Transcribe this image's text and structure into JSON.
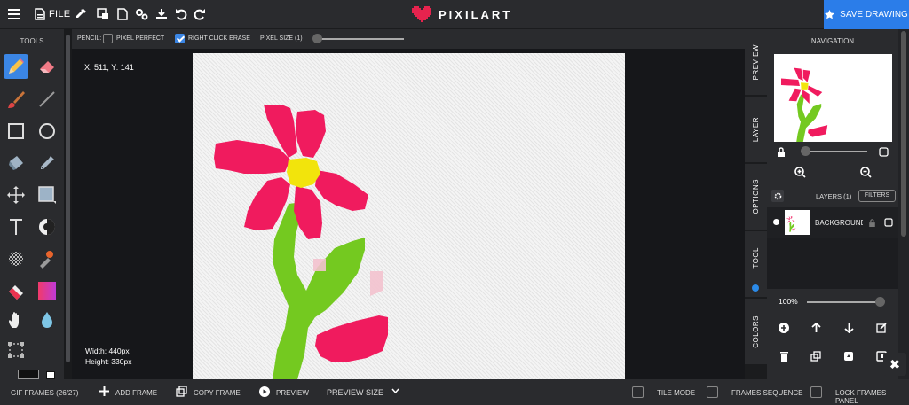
{
  "topbar": {
    "file_label": "FILE",
    "logo_text": "PIXILART",
    "save_label": "SAVE DRAWING",
    "colors": {
      "accent": "#2b7de9",
      "logo_heart": "#e6234e"
    },
    "icons": [
      "file-icon",
      "eyedropper-icon",
      "resize-icon",
      "document-icon",
      "settings-icon",
      "download-icon",
      "undo-icon",
      "redo-icon"
    ]
  },
  "tools": {
    "title": "TOOLS",
    "items": [
      "pencil-icon",
      "eraser-icon",
      "brush-icon",
      "line-icon",
      "rectangle-icon",
      "circle-icon",
      "bucket-icon",
      "eyedropper-icon",
      "move-icon",
      "select-icon",
      "text-icon",
      "shade-icon",
      "dither-icon",
      "stamp-icon",
      "color-replace-icon",
      "gradient-icon",
      "hand-icon",
      "blur-icon",
      "crop-icon"
    ]
  },
  "options": {
    "tool_label": "PENCIL:",
    "pixel_perfect": "PIXEL PERFECT",
    "pixel_perfect_checked": false,
    "right_click_erase": "RIGHT CLICK ERASE",
    "right_click_erase_checked": true,
    "pixel_size": "PIXEL SIZE (1)",
    "pixel_size_value": 1
  },
  "workspace": {
    "coords": "X: 511, Y: 141",
    "width": "Width: 440px",
    "height": "Height: 330px"
  },
  "sidetabs": [
    "PREVIEW",
    "LAYER",
    "OPTIONS",
    "TOOL",
    "COLORS"
  ],
  "navigation": {
    "title": "NAVIGATION",
    "zoom_icons": [
      "zoom-in-icon",
      "zoom-out-icon"
    ]
  },
  "layers": {
    "title": "LAYERS (1)",
    "filters": "FILTERS",
    "items": [
      {
        "name": "BACKGROUND"
      }
    ]
  },
  "colors_panel": {
    "opacity": "100%",
    "opacity_value": 100,
    "icons": [
      "add-icon",
      "arrow-up-icon",
      "arrow-down-icon",
      "edit-icon",
      "trash-icon",
      "duplicate-icon",
      "merge-icon",
      "export-icon"
    ]
  },
  "bottombar": {
    "gif_frames": "GIF FRAMES (26/27)",
    "add_frame": "ADD FRAME",
    "copy_frame": "COPY FRAME",
    "preview": "PREVIEW",
    "preview_size": "PREVIEW SIZE",
    "tile_mode": "TILE MODE",
    "frames_sequence": "FRAMES SEQUENCE",
    "lock_frames_panel": "LOCK FRAMES PANEL"
  },
  "drawing_colors": {
    "petal": "#f01b5e",
    "center": "#f2e40c",
    "stem": "#74c920",
    "ghost": "#f3c2ce"
  }
}
